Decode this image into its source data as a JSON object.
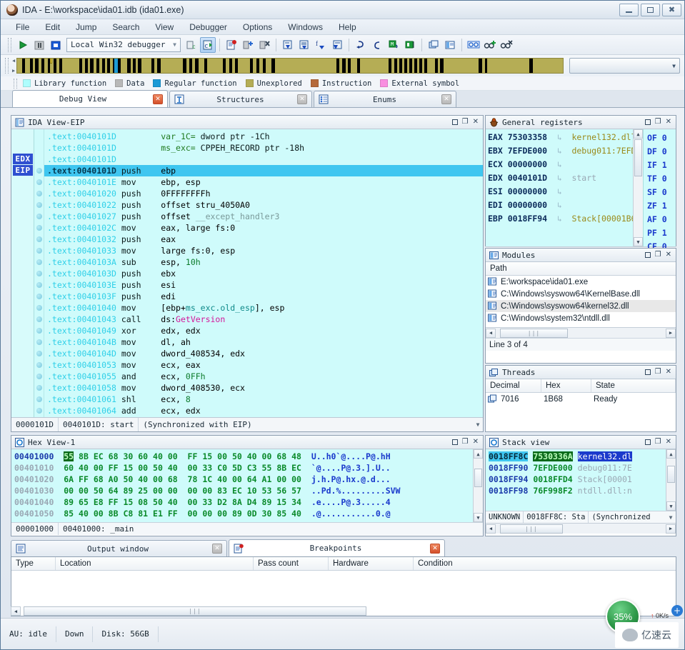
{
  "window": {
    "title": "IDA - E:\\workspace\\ida01.idb (ida01.exe)",
    "minimize": "–",
    "maximize": "□",
    "close": "✕"
  },
  "menu": [
    "File",
    "Edit",
    "Jump",
    "Search",
    "View",
    "Debugger",
    "Options",
    "Windows",
    "Help"
  ],
  "toolbar": {
    "debugger_select": "Local Win32 debugger",
    "dropdown_arrow": "▼"
  },
  "navband": {
    "legend": [
      {
        "label": "Library function",
        "color": "#aefdfd"
      },
      {
        "label": "Data",
        "color": "#b8b8b8"
      },
      {
        "label": "Regular function",
        "color": "#1c9ad6"
      },
      {
        "label": "Unexplored",
        "color": "#b5ad55"
      },
      {
        "label": "Instruction",
        "color": "#b5693a"
      },
      {
        "label": "External symbol",
        "color": "#f98fe0"
      }
    ],
    "base_color": "#b5ad55",
    "mark_color": "#000000",
    "regular_color": "#1c9ad6"
  },
  "view_tabs": [
    {
      "label": "Debug View",
      "icon": "debug-view-icon",
      "active": true
    },
    {
      "label": "Structures",
      "icon": "structures-icon",
      "active": false
    },
    {
      "label": "Enums",
      "icon": "enums-icon",
      "active": false
    }
  ],
  "disassembly": {
    "title": "IDA View-EIP",
    "markers": [
      "EDX",
      "EIP"
    ],
    "status": {
      "offset": "0000101D",
      "address": "0040101D: start",
      "sync": "(Synchronized with EIP)"
    },
    "lines": [
      {
        "addr": ".text:0040101D",
        "mn": "",
        "op": "var_1C= dword ptr -1Ch",
        "kind": "def"
      },
      {
        "addr": ".text:0040101D",
        "mn": "",
        "op": "ms_exc= CPPEH_RECORD ptr -18h",
        "kind": "def"
      },
      {
        "addr": ".text:0040101D",
        "mn": "",
        "op": "",
        "kind": "blank"
      },
      {
        "addr": ".text:0040101D",
        "mn": "push",
        "op": "ebp",
        "kind": "hl"
      },
      {
        "addr": ".text:0040101E",
        "mn": "mov",
        "op": "ebp, esp",
        "kind": "n"
      },
      {
        "addr": ".text:00401020",
        "mn": "push",
        "op": "0FFFFFFFFh",
        "kind": "num"
      },
      {
        "addr": ".text:00401022",
        "mn": "push",
        "op": "offset stru_4050A0",
        "kind": "n"
      },
      {
        "addr": ".text:00401027",
        "mn": "push",
        "op": "offset __except_handler3",
        "kind": "sym"
      },
      {
        "addr": ".text:0040102C",
        "mn": "mov",
        "op": "eax, large fs:0",
        "kind": "n"
      },
      {
        "addr": ".text:00401032",
        "mn": "push",
        "op": "eax",
        "kind": "n"
      },
      {
        "addr": ".text:00401033",
        "mn": "mov",
        "op": "large fs:0, esp",
        "kind": "n"
      },
      {
        "addr": ".text:0040103A",
        "mn": "sub",
        "op": "esp, 10h",
        "kind": "num"
      },
      {
        "addr": ".text:0040103D",
        "mn": "push",
        "op": "ebx",
        "kind": "n"
      },
      {
        "addr": ".text:0040103E",
        "mn": "push",
        "op": "esi",
        "kind": "n"
      },
      {
        "addr": ".text:0040103F",
        "mn": "push",
        "op": "edi",
        "kind": "n"
      },
      {
        "addr": ".text:00401040",
        "mn": "mov",
        "op": "[ebp+ms_exc.old_esp], esp",
        "kind": "struct"
      },
      {
        "addr": ".text:00401043",
        "mn": "call",
        "op": "ds:GetVersion",
        "kind": "api"
      },
      {
        "addr": ".text:00401049",
        "mn": "xor",
        "op": "edx, edx",
        "kind": "n"
      },
      {
        "addr": ".text:0040104B",
        "mn": "mov",
        "op": "dl, ah",
        "kind": "n"
      },
      {
        "addr": ".text:0040104D",
        "mn": "mov",
        "op": "dword_408534, edx",
        "kind": "n"
      },
      {
        "addr": ".text:00401053",
        "mn": "mov",
        "op": "ecx, eax",
        "kind": "n"
      },
      {
        "addr": ".text:00401055",
        "mn": "and",
        "op": "ecx, 0FFh",
        "kind": "num"
      },
      {
        "addr": ".text:00401058",
        "mn": "mov",
        "op": "dword_408530, ecx",
        "kind": "n"
      },
      {
        "addr": ".text:00401061",
        "mn": "shl",
        "op": "ecx, 8",
        "kind": "num"
      },
      {
        "addr": ".text:00401064",
        "mn": "add",
        "op": "ecx, edx",
        "kind": "n"
      }
    ]
  },
  "registers": {
    "title": "General registers",
    "rows": [
      {
        "name": "EAX",
        "value": "75303358",
        "comment": "kernel132.dll:",
        "dim": false
      },
      {
        "name": "EBX",
        "value": "7EFDE000",
        "comment": "debug011:7EFD",
        "dim": false
      },
      {
        "name": "ECX",
        "value": "00000000",
        "comment": "",
        "dim": false
      },
      {
        "name": "EDX",
        "value": "0040101D",
        "comment": "start",
        "dim": true
      },
      {
        "name": "ESI",
        "value": "00000000",
        "comment": "",
        "dim": false
      },
      {
        "name": "EDI",
        "value": "00000000",
        "comment": "",
        "dim": false
      },
      {
        "name": "EBP",
        "value": "0018FF94",
        "comment": "Stack[00001B6",
        "dim": false
      }
    ],
    "flags": [
      {
        "name": "OF",
        "value": "0"
      },
      {
        "name": "DF",
        "value": "0"
      },
      {
        "name": "IF",
        "value": "1"
      },
      {
        "name": "TF",
        "value": "0"
      },
      {
        "name": "SF",
        "value": "0"
      },
      {
        "name": "ZF",
        "value": "1"
      },
      {
        "name": "AF",
        "value": "0"
      },
      {
        "name": "PF",
        "value": "1"
      },
      {
        "name": "CF",
        "value": "0"
      }
    ]
  },
  "modules": {
    "title": "Modules",
    "column": "Path",
    "rows": [
      {
        "path": "E:\\workspace\\ida01.exe",
        "selected": false
      },
      {
        "path": "C:\\Windows\\syswow64\\KernelBase.dll",
        "selected": false
      },
      {
        "path": "C:\\Windows\\syswow64\\kernel32.dll",
        "selected": true
      },
      {
        "path": "C:\\Windows\\system32\\ntdll.dll",
        "selected": false
      }
    ],
    "status": "Line 3 of 4"
  },
  "threads": {
    "title": "Threads",
    "columns": [
      "Decimal",
      "Hex",
      "State"
    ],
    "rows": [
      {
        "decimal": "7016",
        "hex": "1B68",
        "state": "Ready"
      }
    ]
  },
  "hexview": {
    "title": "Hex View-1",
    "rows": [
      {
        "addr": "00401000",
        "bytes": [
          "55",
          "8B",
          "EC",
          "68",
          "30",
          "60",
          "40",
          "00",
          "FF",
          "15",
          "00",
          "50",
          "40",
          "00",
          "68",
          "48"
        ],
        "ascii": "U..h0`@....P@.hH",
        "highlight_first": true,
        "dim": false
      },
      {
        "addr": "00401010",
        "bytes": [
          "60",
          "40",
          "00",
          "FF",
          "15",
          "00",
          "50",
          "40",
          "00",
          "33",
          "C0",
          "5D",
          "C3",
          "55",
          "8B",
          "EC"
        ],
        "ascii": "`@....P@.3.].U..",
        "highlight_first": false,
        "dim": true
      },
      {
        "addr": "00401020",
        "bytes": [
          "6A",
          "FF",
          "68",
          "A0",
          "50",
          "40",
          "00",
          "68",
          "78",
          "1C",
          "40",
          "00",
          "64",
          "A1",
          "00",
          "00"
        ],
        "ascii": "j.h.P@.hx.@.d...",
        "highlight_first": false,
        "dim": true
      },
      {
        "addr": "00401030",
        "bytes": [
          "00",
          "00",
          "50",
          "64",
          "89",
          "25",
          "00",
          "00",
          "00",
          "00",
          "83",
          "EC",
          "10",
          "53",
          "56",
          "57"
        ],
        "ascii": "..Pd.%.........SVW",
        "highlight_first": false,
        "dim": true
      },
      {
        "addr": "00401040",
        "bytes": [
          "89",
          "65",
          "E8",
          "FF",
          "15",
          "08",
          "50",
          "40",
          "00",
          "33",
          "D2",
          "8A",
          "D4",
          "89",
          "15",
          "34"
        ],
        "ascii": ".e....P@.3.....4",
        "highlight_first": false,
        "dim": true
      },
      {
        "addr": "00401050",
        "bytes": [
          "85",
          "40",
          "00",
          "8B",
          "C8",
          "81",
          "E1",
          "FF",
          "00",
          "00",
          "00",
          "89",
          "0D",
          "30",
          "85",
          "40"
        ],
        "ascii": ".@...........0.@",
        "highlight_first": false,
        "dim": true
      }
    ],
    "status": {
      "offset": "00001000",
      "label": "00401000: _main"
    }
  },
  "stackview": {
    "title": "Stack view",
    "rows": [
      {
        "addr": "0018FF8C",
        "value": "7530336A",
        "comment": "kernel32.dl",
        "addr_sel": true,
        "val_hl": true,
        "cmt_hl": true
      },
      {
        "addr": "0018FF90",
        "value": "7EFDE000",
        "comment": "debug011:7E",
        "addr_sel": false,
        "val_hl": false,
        "cmt_hl": false
      },
      {
        "addr": "0018FF94",
        "value": "0018FFD4",
        "comment": "Stack[00001",
        "addr_sel": false,
        "val_hl": false,
        "cmt_hl": false
      },
      {
        "addr": "0018FF98",
        "value": "76F998F2",
        "comment": "ntdll.dll:n",
        "addr_sel": false,
        "val_hl": false,
        "cmt_hl": false
      }
    ],
    "status": {
      "seg": "UNKNOWN",
      "addr": "0018FF8C: Sta",
      "sync": "(Synchronized"
    }
  },
  "bottom_tabs": [
    {
      "label": "Output window",
      "icon": "output-window-icon",
      "active": false
    },
    {
      "label": "Breakpoints",
      "icon": "breakpoints-icon",
      "active": true
    }
  ],
  "breakpoints": {
    "columns": [
      "Type",
      "Location",
      "Pass count",
      "Hardware",
      "Condition"
    ],
    "rows": []
  },
  "statusbar": {
    "au": "AU:  idle",
    "down": "Down",
    "disk": "Disk: 56GB"
  },
  "float": {
    "speed_percent": "35%",
    "net_rate": "0K/s",
    "up_arrow": "↑",
    "down_arrow": "↓",
    "plus": "+",
    "watermark": "亿速云"
  }
}
